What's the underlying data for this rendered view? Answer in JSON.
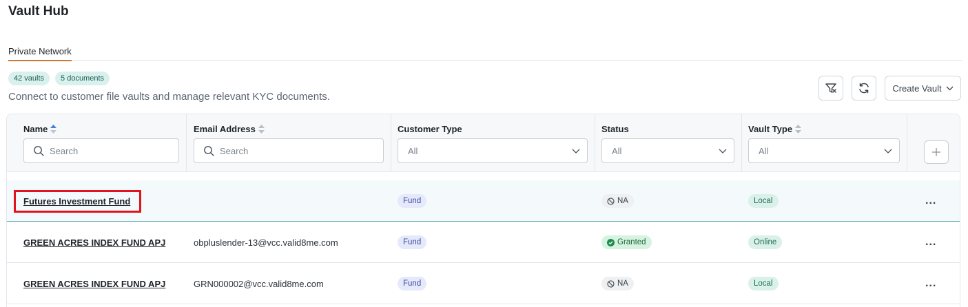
{
  "header": {
    "title": "Vault Hub"
  },
  "tabs": [
    {
      "label": "Private Network"
    }
  ],
  "badges": {
    "vaults": "42 vaults",
    "documents": "5 documents"
  },
  "subtitle": "Connect to customer file vaults and manage relevant KYC documents.",
  "toolbar": {
    "create_label": "Create Vault"
  },
  "table": {
    "columns": {
      "name": "Name",
      "email": "Email Address",
      "customer_type": "Customer Type",
      "status": "Status",
      "vault_type": "Vault Type"
    },
    "filters": {
      "name_placeholder": "Search",
      "email_placeholder": "Search",
      "customer_type": "All",
      "status": "All",
      "vault_type": "All"
    },
    "rows": [
      {
        "name": "Futures Investment Fund",
        "email": "",
        "customer_type": "Fund",
        "status": "NA",
        "vault_type": "Local",
        "more": "..."
      },
      {
        "name": "GREEN ACRES INDEX FUND APJ",
        "email": "obpluslender-13@vcc.valid8me.com",
        "customer_type": "Fund",
        "status": "Granted",
        "vault_type": "Online",
        "more": "..."
      },
      {
        "name": "GREEN ACRES INDEX FUND APJ",
        "email": "GRN000002@vcc.valid8me.com",
        "customer_type": "Fund",
        "status": "NA",
        "vault_type": "Local",
        "more": "..."
      }
    ]
  }
}
